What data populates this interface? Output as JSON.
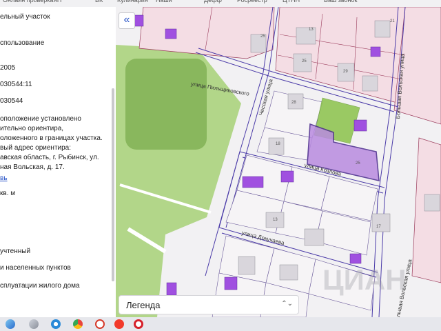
{
  "topbar": {
    "bookmarks": [
      "Онлайн проверка",
      "яП",
      "ВК",
      "Кулинария",
      "Наши",
      "Дефф",
      "Росреестр",
      "ЦТНН",
      "Ваш звонок"
    ]
  },
  "panel": {
    "lines": [
      "ельный участок",
      "спользование",
      "2005",
      "030544:11",
      "030544",
      "оположение установлено",
      "ительно ориентира,",
      "оложенного в границах участка.",
      "вый адрес ориентира:",
      "авская область, г. Рыбинск, ул.",
      "ная Вольская, д. 17.",
      "вь",
      "кв. м",
      "учтенный",
      "и населенных пунктов",
      "сплуатации жилого дома"
    ]
  },
  "map": {
    "collapse_icon_text": "«",
    "legend_label": "Легенда",
    "legend_chevron": "⌃⌄",
    "streets": {
      "pilnikovskogo": "улица Пильщиковского",
      "kozlova": "улица Козлова",
      "dokuchaeva": "улица Докучаева",
      "bolshaya_volskaya": "Большая Вольская улица",
      "bolshaya_volskaya_2": "Большая Вольская улица",
      "chesskaya": "Чесская улица"
    },
    "parcel_numbers": [
      "25",
      "13",
      "25",
      "28",
      "29",
      "21",
      "18",
      "25",
      "13",
      "17"
    ],
    "watermark": "ЦИАН",
    "colors": {
      "green_area": "#8bc34a",
      "selected_parcel": "#b98be0",
      "selected_border": "#4a2a8c",
      "building_marker": "#a050e0",
      "boundary": "#4a3aa8"
    }
  },
  "taskbar": {
    "icons": [
      "finder-icon",
      "launchpad-icon",
      "safari-icon",
      "chrome-icon",
      "yandex-browser-icon",
      "yandex-icon",
      "opera-icon"
    ]
  }
}
